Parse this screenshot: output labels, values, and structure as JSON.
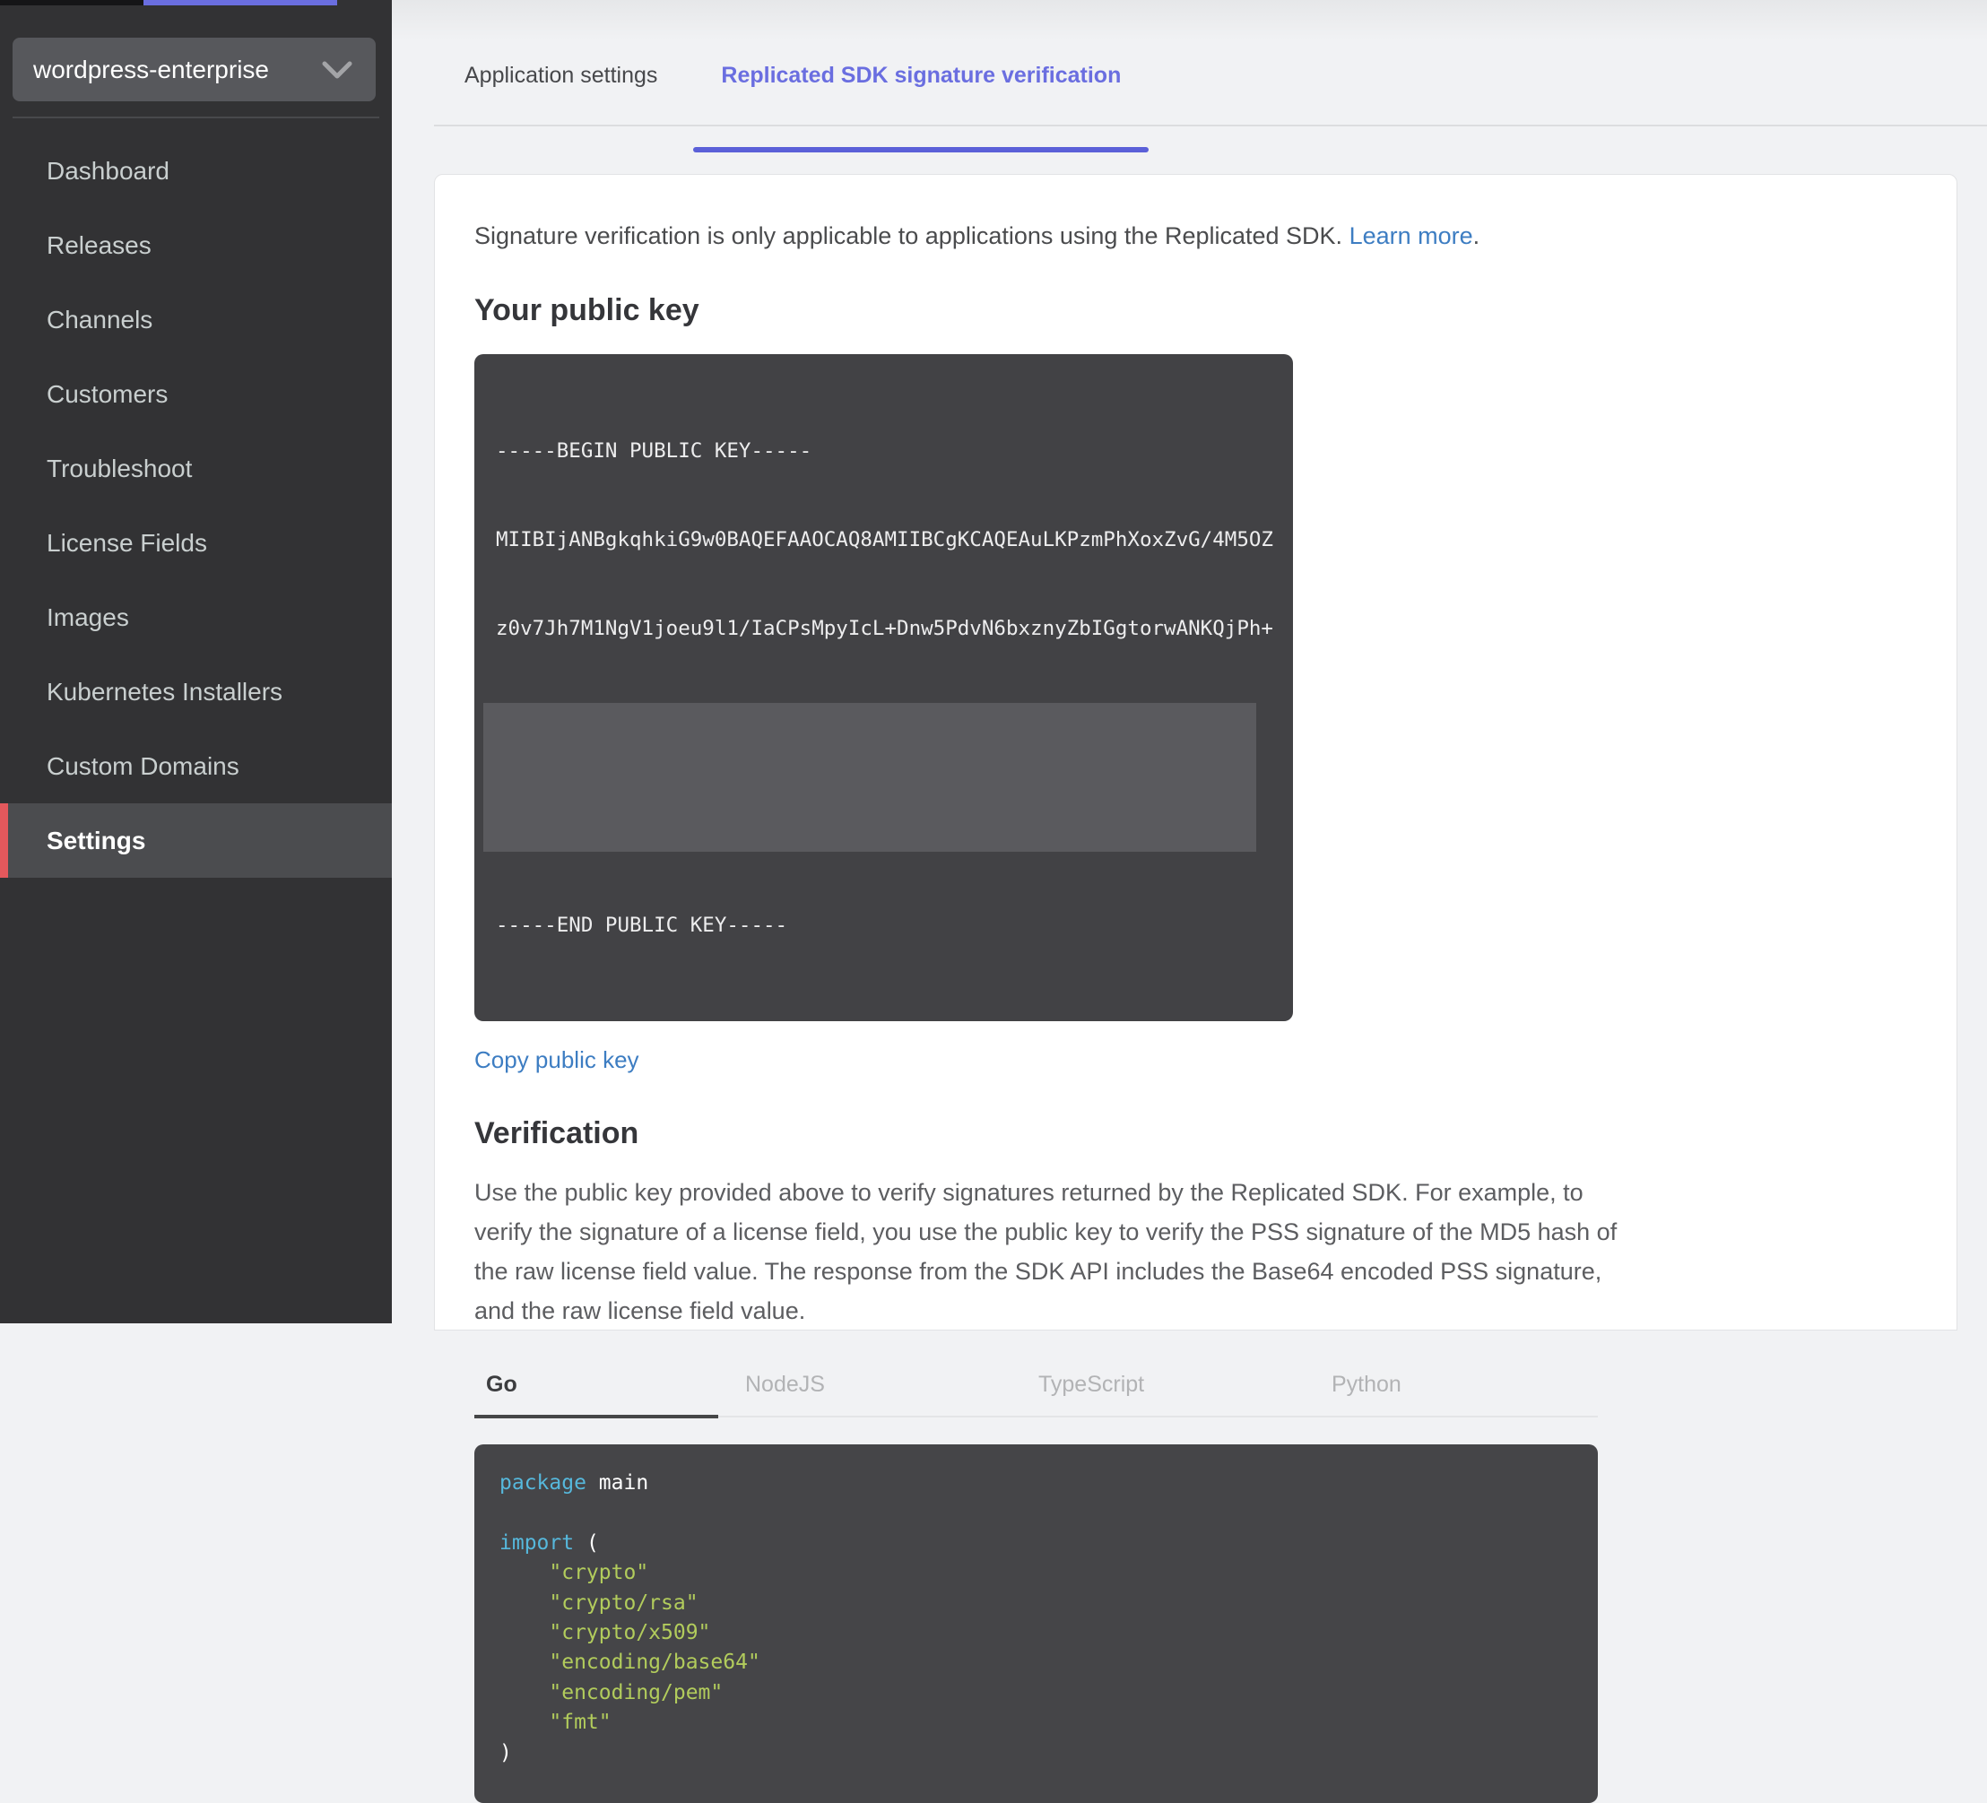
{
  "colors": {
    "accent_indigo": "#6a6ee0",
    "accent_red": "#e4585c",
    "link_blue": "#3d7dc2",
    "code_keyword": "#56b8dc",
    "code_string": "#b2cc5c"
  },
  "sidebar": {
    "app_selector": {
      "value": "wordpress-enterprise"
    },
    "items": [
      {
        "label": "Dashboard",
        "active": false
      },
      {
        "label": "Releases",
        "active": false
      },
      {
        "label": "Channels",
        "active": false
      },
      {
        "label": "Customers",
        "active": false
      },
      {
        "label": "Troubleshoot",
        "active": false
      },
      {
        "label": "License Fields",
        "active": false
      },
      {
        "label": "Images",
        "active": false
      },
      {
        "label": "Kubernetes Installers",
        "active": false
      },
      {
        "label": "Custom Domains",
        "active": false
      },
      {
        "label": "Settings",
        "active": true
      }
    ]
  },
  "tabs": [
    {
      "label": "Application settings",
      "active": false
    },
    {
      "label": "Replicated SDK signature verification",
      "active": true
    }
  ],
  "content": {
    "intro": {
      "text": "Signature verification is only applicable to applications using the Replicated SDK. ",
      "link": "Learn more",
      "suffix": "."
    },
    "public_key": {
      "heading": "Your public key",
      "lines": [
        "-----BEGIN PUBLIC KEY-----",
        "MIIBIjANBgkqhkiG9w0BAQEFAAOCAQ8AMIIBCgKCAQEAuLKPzmPhXoxZvG/4M5OZ",
        "z0v7Jh7M1NgV1joeu9l1/IaCPsMpyIcL+Dnw5PdvN6bxznyZbIGgtorwANKQjPh+"
      ],
      "end_line": "-----END PUBLIC KEY-----",
      "copy_link": "Copy public key"
    },
    "verification": {
      "heading": "Verification",
      "body": "Use the public key provided above to verify signatures returned by the Replicated SDK. For example, to verify the signature of a license field, you use the public key to verify the PSS signature of the MD5 hash of the raw license field value. The response from the SDK API includes the Base64 encoded PSS signature, and the raw license field value.",
      "lang_tabs": [
        {
          "label": "Go",
          "active": true
        },
        {
          "label": "NodeJS",
          "active": false
        },
        {
          "label": "TypeScript",
          "active": false
        },
        {
          "label": "Python",
          "active": false
        }
      ],
      "code": [
        [
          {
            "c": "kw",
            "v": "package"
          },
          {
            "c": "pl",
            "v": " main"
          }
        ],
        [],
        [
          {
            "c": "kw",
            "v": "import"
          },
          {
            "c": "pl",
            "v": " ("
          }
        ],
        [
          {
            "c": "str",
            "v": "    \"crypto\""
          }
        ],
        [
          {
            "c": "str",
            "v": "    \"crypto/rsa\""
          }
        ],
        [
          {
            "c": "str",
            "v": "    \"crypto/x509\""
          }
        ],
        [
          {
            "c": "str",
            "v": "    \"encoding/base64\""
          }
        ],
        [
          {
            "c": "str",
            "v": "    \"encoding/pem\""
          }
        ],
        [
          {
            "c": "str",
            "v": "    \"fmt\""
          }
        ],
        [
          {
            "c": "pl",
            "v": ")"
          }
        ]
      ]
    }
  }
}
